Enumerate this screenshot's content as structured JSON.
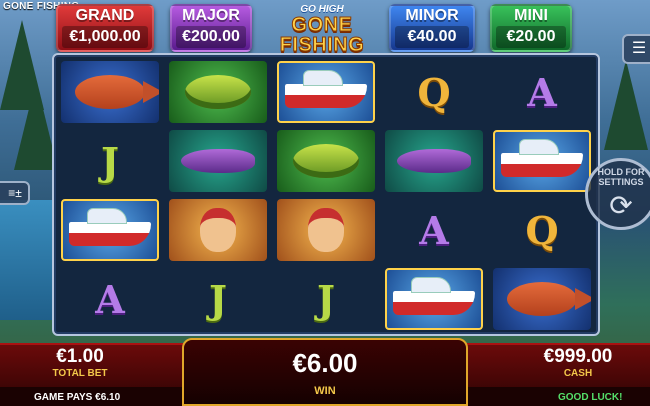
{
  "game_title": "GONE FISHING",
  "logo": {
    "top": "GO HIGH",
    "line1": "GONE",
    "line2": "FISHING"
  },
  "jackpots": [
    {
      "name": "GRAND",
      "value": "€1,000.00"
    },
    {
      "name": "MAJOR",
      "value": "€200.00"
    },
    {
      "name": "MINOR",
      "value": "€40.00"
    },
    {
      "name": "MINI",
      "value": "€20.00"
    }
  ],
  "reels": [
    [
      "fish",
      "J",
      "boat",
      "A"
    ],
    [
      "bass",
      "cat",
      "man",
      "J"
    ],
    [
      "boat",
      "bass",
      "man",
      "J"
    ],
    [
      "Q",
      "cat",
      "A",
      "boat"
    ],
    [
      "A",
      "boat",
      "Q",
      "fish"
    ]
  ],
  "spin_hint": "HOLD FOR SETTINGS",
  "bottom": {
    "total_bet_value": "€1.00",
    "total_bet_label": "TOTAL BET",
    "win_value": "€6.00",
    "win_label": "WIN",
    "cash_value": "€999.00",
    "cash_label": "CASH",
    "game_pays": "GAME PAYS €6.10",
    "message": "GOOD LUCK!"
  }
}
